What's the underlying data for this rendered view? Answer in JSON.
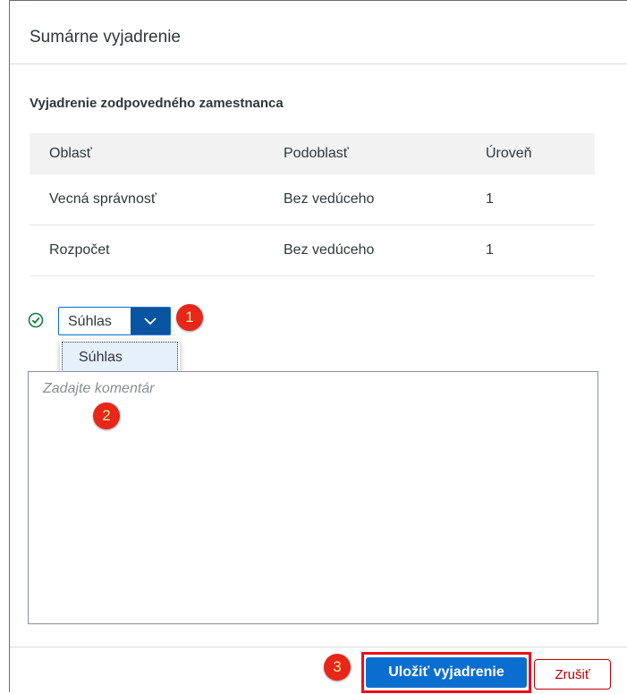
{
  "dialog": {
    "title": "Sumárne vyjadrenie",
    "section_title": "Vyjadrenie zodpovedného zamestnanca"
  },
  "table": {
    "headers": [
      "Oblasť",
      "Podoblasť",
      "Úroveň"
    ],
    "rows": [
      [
        "Vecná správnosť",
        "Bez vedúceho",
        "1"
      ],
      [
        "Rozpočet",
        "Bez vedúceho",
        "1"
      ]
    ]
  },
  "decision": {
    "selected": "Súhlas",
    "options": [
      "Súhlas"
    ]
  },
  "comment": {
    "placeholder": "Zadajte komentár",
    "value": ""
  },
  "annotations": [
    "1",
    "2",
    "3"
  ],
  "footer": {
    "save_label": "Uložiť vyjadrenie",
    "cancel_label": "Zrušiť"
  },
  "colors": {
    "accent": "#0a6ed1",
    "select_arrow": "#0854a0",
    "reject": "#bb0000",
    "success": "#107e3e",
    "badge": "#e8261a",
    "highlight": "#e8101c"
  }
}
